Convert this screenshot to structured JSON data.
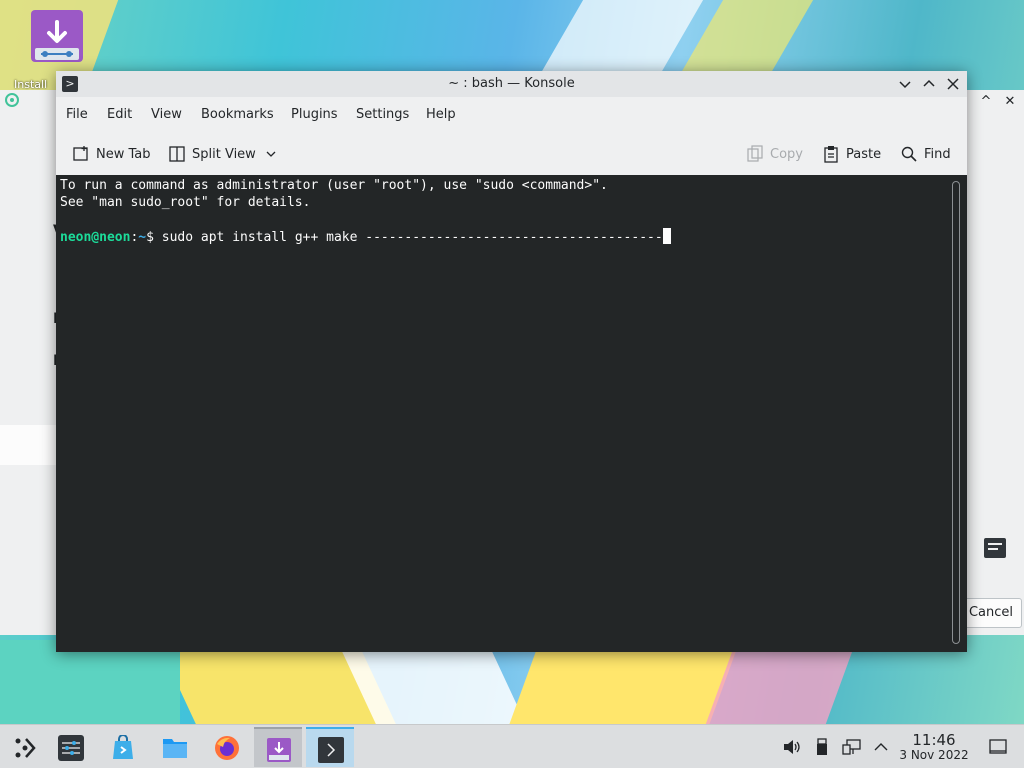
{
  "desktop": {
    "icon_label": "Install"
  },
  "background_window": {
    "cancel_label": "Cancel",
    "markers": [
      "V",
      "I",
      "I"
    ]
  },
  "konsole": {
    "title": "~ : bash — Konsole",
    "menu": [
      "File",
      "Edit",
      "View",
      "Bookmarks",
      "Plugins",
      "Settings",
      "Help"
    ],
    "toolbar": {
      "new_tab": "New Tab",
      "split_view": "Split View",
      "copy": "Copy",
      "paste": "Paste",
      "find": "Find"
    },
    "terminal": {
      "line1": "To run a command as administrator (user \"root\"), use \"sudo <command>\".",
      "line2": "See \"man sudo_root\" for details.",
      "prompt_user": "neon@neon",
      "prompt_sep": ":",
      "prompt_path": "~",
      "prompt_symbol": "$ ",
      "command": "sudo apt install g++ make --------------------------------------"
    },
    "icons": {
      "app": "terminal-icon",
      "minimize": "chevron-down-icon",
      "maximize": "chevron-up-icon",
      "close": "close-icon"
    }
  },
  "taskbar": {
    "clock_time": "11:46",
    "clock_date": "3 Nov 2022",
    "tasks": [
      "application-launcher",
      "system-settings",
      "discover",
      "file-manager",
      "firefox",
      "installer",
      "konsole"
    ],
    "tray": [
      "volume-icon",
      "usb-device-icon",
      "network-icon",
      "expand-tray-icon",
      "show-desktop-icon"
    ]
  },
  "colors": {
    "terminal_bg": "#232627",
    "prompt_user": "#1cdc9a",
    "prompt_path": "#3daee9",
    "accent": "#3daee9"
  }
}
